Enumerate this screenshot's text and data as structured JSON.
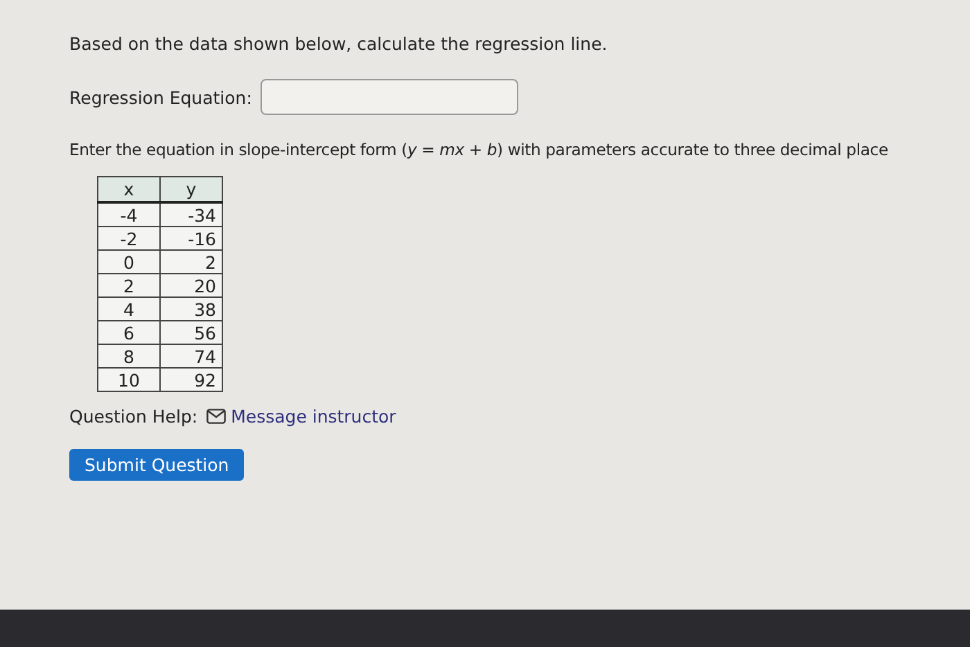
{
  "prompt": "Based on the data shown below, calculate the regression line.",
  "answer": {
    "label": "Regression Equation:"
  },
  "instruction": "Enter the equation in slope-intercept form (*y* = *mx* + *b*) with parameters accurate to three decimal place",
  "table": {
    "columns": [
      "x",
      "y"
    ],
    "rows": [
      [
        "-4",
        "-34"
      ],
      [
        "-2",
        "-16"
      ],
      [
        "0",
        "2"
      ],
      [
        "2",
        "20"
      ],
      [
        "4",
        "38"
      ],
      [
        "6",
        "56"
      ],
      [
        "8",
        "74"
      ],
      [
        "10",
        "92"
      ]
    ]
  },
  "help": {
    "label": "Question Help:",
    "link": "Message instructor"
  },
  "submit": "Submit Question"
}
